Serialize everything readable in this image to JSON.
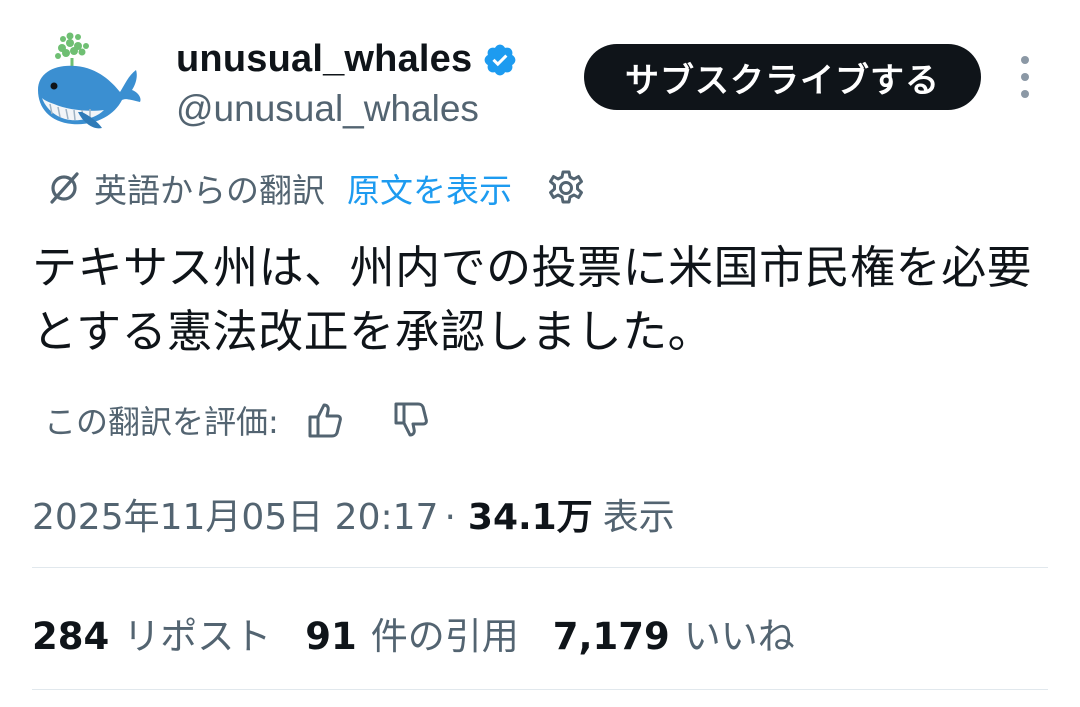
{
  "author": {
    "display_name": "unusual_whales",
    "handle": "@unusual_whales",
    "verified": true,
    "avatar_icon": "whale-icon"
  },
  "subscribe_label": "サブスクライブする",
  "translation": {
    "label": "英語からの翻訳",
    "show_original": "原文を表示"
  },
  "tweet_text": "テキサス州は、州内での投票に米国市民権を必要とする憲法改正を承認しました。",
  "rating": {
    "label": "この翻訳を評価:"
  },
  "meta": {
    "timestamp": "2025年11月05日 20:17",
    "separator": "·",
    "views_count": "34.1万",
    "views_label": "表示"
  },
  "stats": [
    {
      "count": "284",
      "label": "リポスト"
    },
    {
      "count": "91",
      "label": "件の引用"
    },
    {
      "count": "7,179",
      "label": "いいね"
    }
  ],
  "colors": {
    "accent": "#1d9bf0",
    "text": "#0f1419",
    "muted": "#536471",
    "button_bg": "#0f1419"
  }
}
